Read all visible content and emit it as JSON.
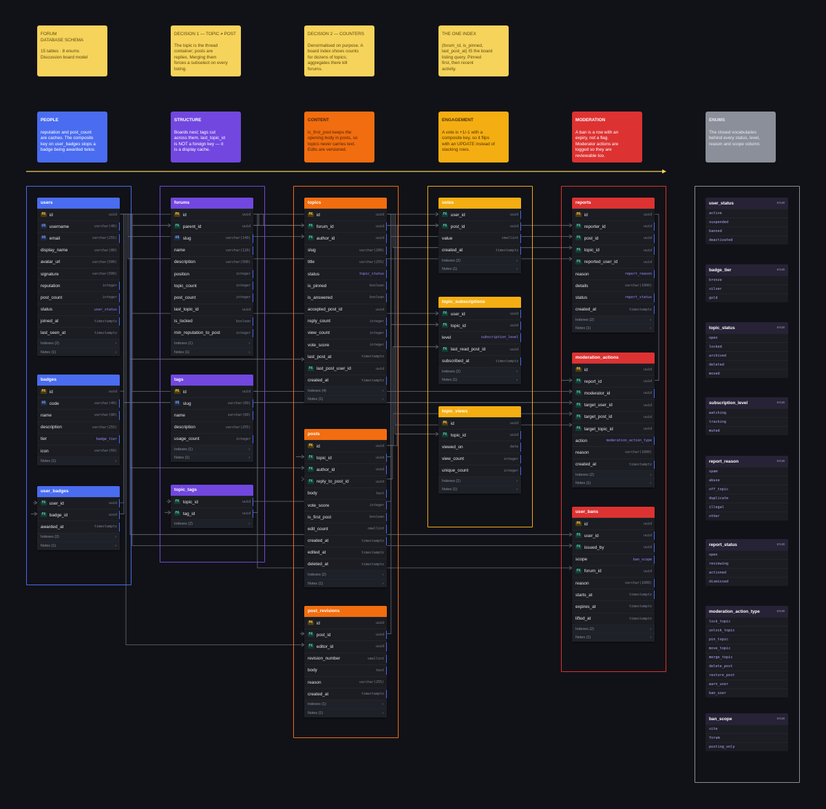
{
  "notes": [
    {
      "title": "FORUM\nDATABASE SCHEMA",
      "body": "15 tables · 8 enums\nDiscussion board model"
    },
    {
      "title": "DECISION 1 — TOPIC ≠ POST",
      "body": "The topic is the thread\ncontainer; posts are\nreplies. Merging them\nforces a subselect on every\nlisting."
    },
    {
      "title": "DECISION 2 — COUNTERS",
      "body": "Denormalised on purpose. A\nboard index shows counts\nfor dozens of topics;\naggregates there kill\nforums."
    },
    {
      "title": "THE ONE INDEX",
      "body": "(forum_id, is_pinned,\nlast_post_at) IS the board\nlisting query. Pinned\nfirst, then recent\nactivity."
    }
  ],
  "categories": [
    {
      "title": "PEOPLE",
      "body": "reputation and post_count\nare caches. The composite\nkey on user_badges stops a\nbadge being awarded twice.",
      "color": "#4a6cf0",
      "text": "#ffffff"
    },
    {
      "title": "STRUCTURE",
      "body": "Boards nest; tags cut\nacross them. last_topic_id\nis NOT a foreign key — it\nis a display cache.",
      "color": "#7147e0",
      "text": "#ffffff"
    },
    {
      "title": "CONTENT",
      "body": "is_first_post keeps the\nopening body in posts, so\ntopics never carries text.\nEdits are versioned.",
      "color": "#f26d0f",
      "text": "#4a2406"
    },
    {
      "title": "ENGAGEMENT",
      "body": "A vote is +1/-1 with a\ncomposite key, so it flips\nwith an UPDATE instead of\nstacking rows.",
      "color": "#f5ae12",
      "text": "#4a3306"
    },
    {
      "title": "MODERATION",
      "body": "A ban is a row with an\nexpiry, not a flag.\nModerator actions are\nlogged so they are\nreviewable too.",
      "color": "#dd3232",
      "text": "#ffffff"
    },
    {
      "title": "ENUMS",
      "body": "The closed vocabularies\nbehind every status, level,\nreason and scope column.",
      "color": "#8a8f99",
      "text": "#e9eaee"
    }
  ],
  "colors": {
    "people": "#4a6cf0",
    "structure": "#7147e0",
    "content": "#f26d0f",
    "engagement": "#f5ae12",
    "moderation": "#dd3232",
    "enums": "#8a8f99",
    "timeline": "#f6d35a",
    "link": "#6b6f7a"
  },
  "tables": {
    "users": {
      "name": "users",
      "rows": [
        [
          "PK",
          "id",
          "uuid",
          0
        ],
        [
          "UQ",
          "username",
          "varchar(40)",
          1
        ],
        [
          "UQ",
          "email",
          "varchar(255)",
          1
        ],
        [
          "",
          "display_name",
          "varchar(80)",
          0
        ],
        [
          "",
          "avatar_url",
          "varchar(500)",
          0
        ],
        [
          "",
          "signature",
          "varchar(500)",
          0
        ],
        [
          "",
          "reputation",
          "integer",
          1
        ],
        [
          "",
          "post_count",
          "integer",
          1
        ],
        [
          "",
          "status",
          "user_status",
          1
        ],
        [
          "",
          "joined_at",
          "timestamptz",
          1
        ],
        [
          "",
          "last_seen_at",
          "timestamptz",
          0
        ]
      ],
      "foot": [
        [
          "Indexes (2)"
        ],
        [
          "Notes (1)"
        ]
      ]
    },
    "badges": {
      "name": "badges",
      "rows": [
        [
          "PK",
          "id",
          "uuid",
          0
        ],
        [
          "UQ",
          "code",
          "varchar(40)",
          1
        ],
        [
          "",
          "name",
          "varchar(80)",
          1
        ],
        [
          "",
          "description",
          "varchar(255)",
          0
        ],
        [
          "",
          "tier",
          "badge_tier",
          1
        ],
        [
          "",
          "icon",
          "varchar(60)",
          0
        ]
      ],
      "foot": [
        [
          "Notes (1)"
        ]
      ]
    },
    "user_badges": {
      "name": "user_badges",
      "rows": [
        [
          "FK",
          "user_id",
          "uuid",
          1
        ],
        [
          "FK",
          "badge_id",
          "uuid",
          1
        ],
        [
          "",
          "awarded_at",
          "timestamptz",
          1
        ]
      ],
      "foot": [
        [
          "Indexes (2)"
        ],
        [
          "Notes (1)"
        ]
      ]
    },
    "forums": {
      "name": "forums",
      "rows": [
        [
          "PK",
          "id",
          "uuid",
          0
        ],
        [
          "FK",
          "parent_id",
          "uuid",
          0
        ],
        [
          "UQ",
          "slug",
          "varchar(140)",
          1
        ],
        [
          "",
          "name",
          "varchar(120)",
          1
        ],
        [
          "",
          "description",
          "varchar(500)",
          0
        ],
        [
          "",
          "position",
          "integer",
          1
        ],
        [
          "",
          "topic_count",
          "integer",
          1
        ],
        [
          "",
          "post_count",
          "integer",
          1
        ],
        [
          "",
          "last_topic_id",
          "uuid",
          0
        ],
        [
          "",
          "is_locked",
          "boolean",
          1
        ],
        [
          "",
          "min_reputation_to_post",
          "integer",
          1
        ]
      ],
      "foot": [
        [
          "Indexes (1)"
        ],
        [
          "Notes (1)"
        ]
      ]
    },
    "tags": {
      "name": "tags",
      "rows": [
        [
          "PK",
          "id",
          "uuid",
          0
        ],
        [
          "UQ",
          "slug",
          "varchar(60)",
          1
        ],
        [
          "",
          "name",
          "varchar(60)",
          1
        ],
        [
          "",
          "description",
          "varchar(255)",
          0
        ],
        [
          "",
          "usage_count",
          "integer",
          1
        ]
      ],
      "foot": [
        [
          "Indexes (1)"
        ],
        [
          "Notes (1)"
        ]
      ]
    },
    "topic_tags": {
      "name": "topic_tags",
      "rows": [
        [
          "FK",
          "topic_id",
          "uuid",
          1
        ],
        [
          "FK",
          "tag_id",
          "uuid",
          1
        ]
      ],
      "foot": [
        [
          "Indexes (2)"
        ]
      ]
    },
    "topics": {
      "name": "topics",
      "rows": [
        [
          "PK",
          "id",
          "uuid",
          0
        ],
        [
          "FK",
          "forum_id",
          "uuid",
          1
        ],
        [
          "FK",
          "author_id",
          "uuid",
          1
        ],
        [
          "",
          "slug",
          "varchar(200)",
          1
        ],
        [
          "",
          "title",
          "varchar(255)",
          1
        ],
        [
          "",
          "status",
          "topic_status",
          1
        ],
        [
          "",
          "is_pinned",
          "boolean",
          1
        ],
        [
          "",
          "is_answered",
          "boolean",
          1
        ],
        [
          "",
          "accepted_post_id",
          "uuid",
          0
        ],
        [
          "",
          "reply_count",
          "integer",
          1
        ],
        [
          "",
          "view_count",
          "integer",
          1
        ],
        [
          "",
          "vote_score",
          "integer",
          1
        ],
        [
          "",
          "last_post_at",
          "timestamptz",
          0
        ],
        [
          "FK",
          "last_post_user_id",
          "uuid",
          0
        ],
        [
          "",
          "created_at",
          "timestamptz",
          1
        ]
      ],
      "foot": [
        [
          "Indexes (4)"
        ],
        [
          "Notes (1)"
        ]
      ]
    },
    "posts": {
      "name": "posts",
      "rows": [
        [
          "PK",
          "id",
          "uuid",
          0
        ],
        [
          "FK",
          "topic_id",
          "uuid",
          1
        ],
        [
          "FK",
          "author_id",
          "uuid",
          1
        ],
        [
          "FK",
          "reply_to_post_id",
          "uuid",
          0
        ],
        [
          "",
          "body",
          "text",
          1
        ],
        [
          "",
          "vote_score",
          "integer",
          1
        ],
        [
          "",
          "is_first_post",
          "boolean",
          1
        ],
        [
          "",
          "edit_count",
          "smallint",
          1
        ],
        [
          "",
          "created_at",
          "timestamptz",
          1
        ],
        [
          "",
          "edited_at",
          "timestamptz",
          0
        ],
        [
          "",
          "deleted_at",
          "timestamptz",
          0
        ]
      ],
      "foot": [
        [
          "Indexes (2)"
        ],
        [
          "Notes (1)"
        ]
      ]
    },
    "post_revisions": {
      "name": "post_revisions",
      "rows": [
        [
          "PK",
          "id",
          "uuid",
          0
        ],
        [
          "FK",
          "post_id",
          "uuid",
          1
        ],
        [
          "FK",
          "editor_id",
          "uuid",
          1
        ],
        [
          "",
          "revision_number",
          "smallint",
          1
        ],
        [
          "",
          "body",
          "text",
          1
        ],
        [
          "",
          "reason",
          "varchar(255)",
          0
        ],
        [
          "",
          "created_at",
          "timestamptz",
          1
        ]
      ],
      "foot": [
        [
          "Indexes (1)"
        ],
        [
          "Notes (1)"
        ]
      ]
    },
    "votes": {
      "name": "votes",
      "rows": [
        [
          "FK",
          "user_id",
          "uuid",
          1
        ],
        [
          "FK",
          "post_id",
          "uuid",
          1
        ],
        [
          "",
          "value",
          "smallint",
          1
        ],
        [
          "",
          "created_at",
          "timestamptz",
          1
        ]
      ],
      "foot": [
        [
          "Indexes (2)"
        ],
        [
          "Notes (1)"
        ]
      ]
    },
    "topic_subscriptions": {
      "name": "topic_subscriptions",
      "rows": [
        [
          "FK",
          "user_id",
          "uuid",
          1
        ],
        [
          "FK",
          "topic_id",
          "uuid",
          1
        ],
        [
          "",
          "level",
          "subscription_level",
          1
        ],
        [
          "FK",
          "last_read_post_id",
          "uuid",
          0
        ],
        [
          "",
          "subscribed_at",
          "timestamptz",
          1
        ]
      ],
      "foot": [
        [
          "Indexes (2)"
        ],
        [
          "Notes (1)"
        ]
      ]
    },
    "topic_views": {
      "name": "topic_views",
      "rows": [
        [
          "PK",
          "id",
          "uuid",
          0
        ],
        [
          "FK",
          "topic_id",
          "uuid",
          1
        ],
        [
          "",
          "viewed_on",
          "date",
          1
        ],
        [
          "",
          "view_count",
          "integer",
          1
        ],
        [
          "",
          "unique_count",
          "integer",
          1
        ]
      ],
      "foot": [
        [
          "Indexes (1)"
        ],
        [
          "Notes (1)"
        ]
      ]
    },
    "reports": {
      "name": "reports",
      "rows": [
        [
          "PK",
          "id",
          "uuid",
          0
        ],
        [
          "FK",
          "reporter_id",
          "uuid",
          1
        ],
        [
          "FK",
          "post_id",
          "uuid",
          1
        ],
        [
          "FK",
          "topic_id",
          "uuid",
          1
        ],
        [
          "FK",
          "reported_user_id",
          "uuid",
          0
        ],
        [
          "",
          "reason",
          "report_reason",
          1
        ],
        [
          "",
          "details",
          "varchar(1000)",
          0
        ],
        [
          "",
          "status",
          "report_status",
          1
        ],
        [
          "",
          "created_at",
          "timestamptz",
          1
        ]
      ],
      "foot": [
        [
          "Indexes (2)"
        ],
        [
          "Notes (1)"
        ]
      ]
    },
    "moderation_actions": {
      "name": "moderation_actions",
      "rows": [
        [
          "PK",
          "id",
          "uuid",
          0
        ],
        [
          "FK",
          "report_id",
          "uuid",
          0
        ],
        [
          "FK",
          "moderator_id",
          "uuid",
          1
        ],
        [
          "FK",
          "target_user_id",
          "uuid",
          0
        ],
        [
          "FK",
          "target_post_id",
          "uuid",
          0
        ],
        [
          "FK",
          "target_topic_id",
          "uuid",
          0
        ],
        [
          "",
          "action",
          "moderation_action_type",
          1
        ],
        [
          "",
          "reason",
          "varchar(1000)",
          0
        ],
        [
          "",
          "created_at",
          "timestamptz",
          1
        ]
      ],
      "foot": [
        [
          "Indexes (2)"
        ],
        [
          "Notes (1)"
        ]
      ]
    },
    "user_bans": {
      "name": "user_bans",
      "rows": [
        [
          "PK",
          "id",
          "uuid",
          0
        ],
        [
          "FK",
          "user_id",
          "uuid",
          1
        ],
        [
          "FK",
          "issued_by",
          "uuid",
          1
        ],
        [
          "",
          "scope",
          "ban_scope",
          1
        ],
        [
          "FK",
          "forum_id",
          "uuid",
          0
        ],
        [
          "",
          "reason",
          "varchar(1000)",
          1
        ],
        [
          "",
          "starts_at",
          "timestamptz",
          1
        ],
        [
          "",
          "expires_at",
          "timestamptz",
          0
        ],
        [
          "",
          "lifted_at",
          "timestamptz",
          0
        ]
      ],
      "foot": [
        [
          "Indexes (2)"
        ],
        [
          "Notes (1)"
        ]
      ]
    }
  },
  "enums": [
    {
      "name": "user_status",
      "tag": "enum",
      "values": [
        "active",
        "suspended",
        "banned",
        "deactivated"
      ]
    },
    {
      "name": "badge_tier",
      "tag": "enum",
      "values": [
        "bronze",
        "silver",
        "gold"
      ]
    },
    {
      "name": "topic_status",
      "tag": "enum",
      "values": [
        "open",
        "locked",
        "archived",
        "deleted",
        "moved"
      ]
    },
    {
      "name": "subscription_level",
      "tag": "enum",
      "values": [
        "watching",
        "tracking",
        "muted"
      ]
    },
    {
      "name": "report_reason",
      "tag": "enum",
      "values": [
        "spam",
        "abuse",
        "off_topic",
        "duplicate",
        "illegal",
        "other"
      ]
    },
    {
      "name": "report_status",
      "tag": "enum",
      "values": [
        "open",
        "reviewing",
        "actioned",
        "dismissed"
      ]
    },
    {
      "name": "moderation_action_type",
      "tag": "enum",
      "values": [
        "lock_topic",
        "unlock_topic",
        "pin_topic",
        "move_topic",
        "merge_topic",
        "delete_post",
        "restore_post",
        "warn_user",
        "ban_user"
      ]
    },
    {
      "name": "ban_scope",
      "tag": "enum",
      "values": [
        "site",
        "forum",
        "posting_only"
      ]
    }
  ]
}
